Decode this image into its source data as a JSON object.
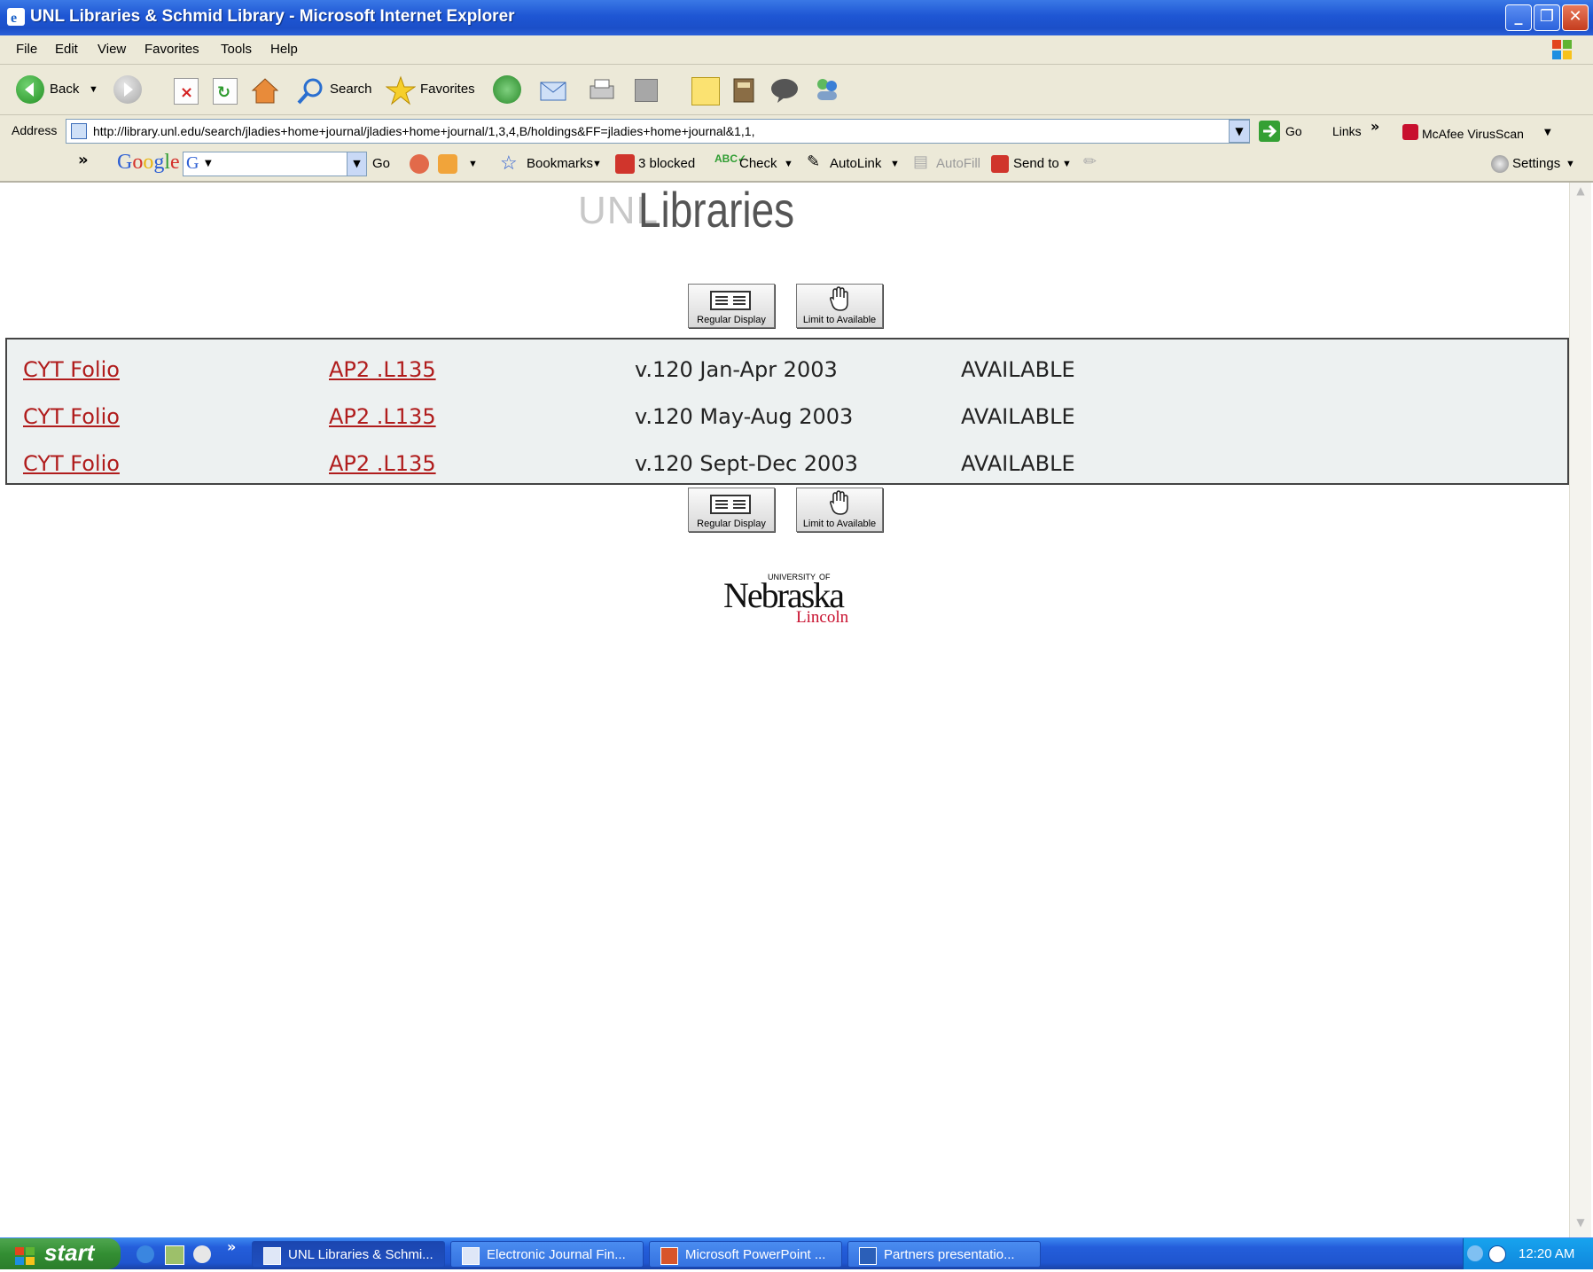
{
  "window": {
    "title": "UNL Libraries & Schmid Library - Microsoft Internet Explorer"
  },
  "menu": [
    "File",
    "Edit",
    "View",
    "Favorites",
    "Tools",
    "Help"
  ],
  "toolbar": {
    "back": "Back",
    "search": "Search",
    "favorites": "Favorites"
  },
  "address": {
    "label": "Address",
    "url": "http://library.unl.edu/search/jladies+home+journal/jladies+home+journal/1,3,4,B/holdings&FF=jladies+home+journal&1,1,",
    "go": "Go",
    "links": "Links",
    "mcafee": "McAfee VirusScan"
  },
  "googlebar": {
    "brand": "Google",
    "go": "Go",
    "bookmarks": "Bookmarks",
    "blocked": "3 blocked",
    "check": "Check",
    "autolink": "AutoLink",
    "autofill": "AutoFill",
    "sendto": "Send to",
    "settings": "Settings"
  },
  "page": {
    "logo_unl": "UNL",
    "logo_libraries": "Libraries",
    "buttons": {
      "regular": "Regular Display",
      "limit": "Limit to Available"
    },
    "holdings": [
      {
        "location": "CYT Folio",
        "call": "AP2 .L135",
        "volume": "v.120 Jan-Apr 2003",
        "status": "AVAILABLE"
      },
      {
        "location": "CYT Folio",
        "call": "AP2 .L135",
        "volume": "v.120 May-Aug 2003",
        "status": "AVAILABLE"
      },
      {
        "location": "CYT Folio",
        "call": "AP2 .L135",
        "volume": "v.120 Sept-Dec 2003",
        "status": "AVAILABLE"
      }
    ],
    "nebraska": {
      "university": "UNIVERSITY",
      "of": "OF",
      "name": "Nebraska",
      "city": "Lincoln"
    }
  },
  "taskbar": {
    "start": "start",
    "tasks": [
      "UNL Libraries & Schmi...",
      "Electronic Journal Fin...",
      "Microsoft PowerPoint ...",
      "Partners presentatio..."
    ],
    "clock": "12:20 AM"
  },
  "colors": {
    "link": "#b01c1c",
    "nebraska_red": "#c8102e",
    "xp_blue": "#245edb"
  }
}
